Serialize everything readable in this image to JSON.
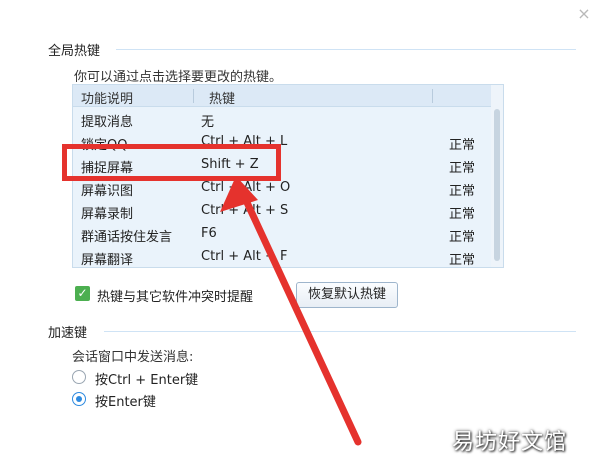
{
  "close_glyph": "×",
  "global_hotkeys": {
    "section_title": "全局热键",
    "hint": "你可以通过点击选择要更改的热键。",
    "columns": {
      "function": "功能说明",
      "hotkey": "热键"
    },
    "rows": [
      {
        "function": "提取消息",
        "hotkey": "无",
        "status": ""
      },
      {
        "function": "锁定QQ",
        "hotkey": "Ctrl + Alt + L",
        "status": "正常"
      },
      {
        "function": "捕捉屏幕",
        "hotkey": "Shift + Z",
        "status": "正常"
      },
      {
        "function": "屏幕识图",
        "hotkey": "Ctrl + Alt + O",
        "status": "正常"
      },
      {
        "function": "屏幕录制",
        "hotkey": "Ctrl + Alt + S",
        "status": "正常"
      },
      {
        "function": "群通话按住发言",
        "hotkey": "F6",
        "status": "正常"
      },
      {
        "function": "屏幕翻译",
        "hotkey": "Ctrl + Alt + F",
        "status": "正常"
      }
    ],
    "conflict_check": {
      "checked": true,
      "label": "热键与其它软件冲突时提醒"
    },
    "restore_button": "恢复默认热键"
  },
  "accelerator": {
    "section_title": "加速键",
    "hint": "会话窗口中发送消息:",
    "options": [
      {
        "label": "按Ctrl + Enter键",
        "selected": false
      },
      {
        "label": "按Enter键",
        "selected": true
      }
    ]
  },
  "annotation_color": "#e5322d",
  "accent_color": "#2d8ae0",
  "watermark": "易坊好文馆"
}
